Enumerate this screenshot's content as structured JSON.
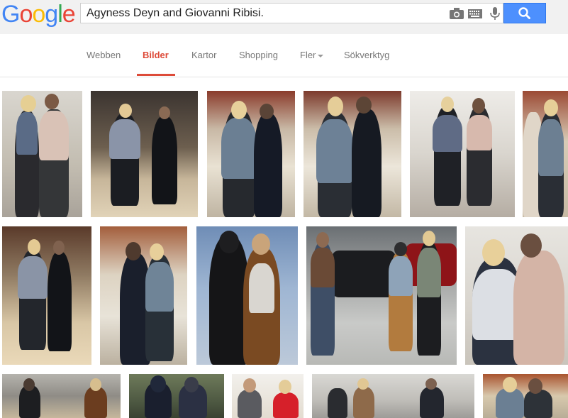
{
  "logo": {
    "letters": [
      "G",
      "o",
      "o",
      "g",
      "l",
      "e"
    ],
    "colors": [
      "#4285f4",
      "#ea4335",
      "#fbbc05",
      "#4285f4",
      "#34a853",
      "#ea4335"
    ]
  },
  "search": {
    "query": "Agyness Deyn and Giovanni Ribisi."
  },
  "icons": {
    "camera": "camera-icon",
    "keyboard": "keyboard-icon",
    "mic": "microphone-icon",
    "search": "magnifier-icon"
  },
  "tabs": [
    {
      "label": "Webben"
    },
    {
      "label": "Bilder"
    },
    {
      "label": "Kartor"
    },
    {
      "label": "Shopping"
    },
    {
      "label": "Fler"
    },
    {
      "label": "Sökverktyg"
    }
  ],
  "colors": {
    "accent": "#dd4b39",
    "search_button": "#4d90fe",
    "header_bg": "#f1f1f1"
  },
  "images": [
    {
      "alt": "Hug by van"
    },
    {
      "alt": "Walking in store"
    },
    {
      "alt": "Kiss at shelves"
    },
    {
      "alt": "Kiss at shelves 2"
    },
    {
      "alt": "Steps outside house"
    },
    {
      "alt": "Pair partial"
    },
    {
      "alt": "Walking grocery"
    },
    {
      "alt": "Kiss in store"
    },
    {
      "alt": "Hoodie kiss"
    },
    {
      "alt": "Parking lot walk"
    },
    {
      "alt": "Hug close-up"
    },
    {
      "alt": "Beach"
    },
    {
      "alt": "Street hoodies"
    },
    {
      "alt": "Event red dress"
    },
    {
      "alt": "Group crowd"
    },
    {
      "alt": "Store hug"
    }
  ]
}
